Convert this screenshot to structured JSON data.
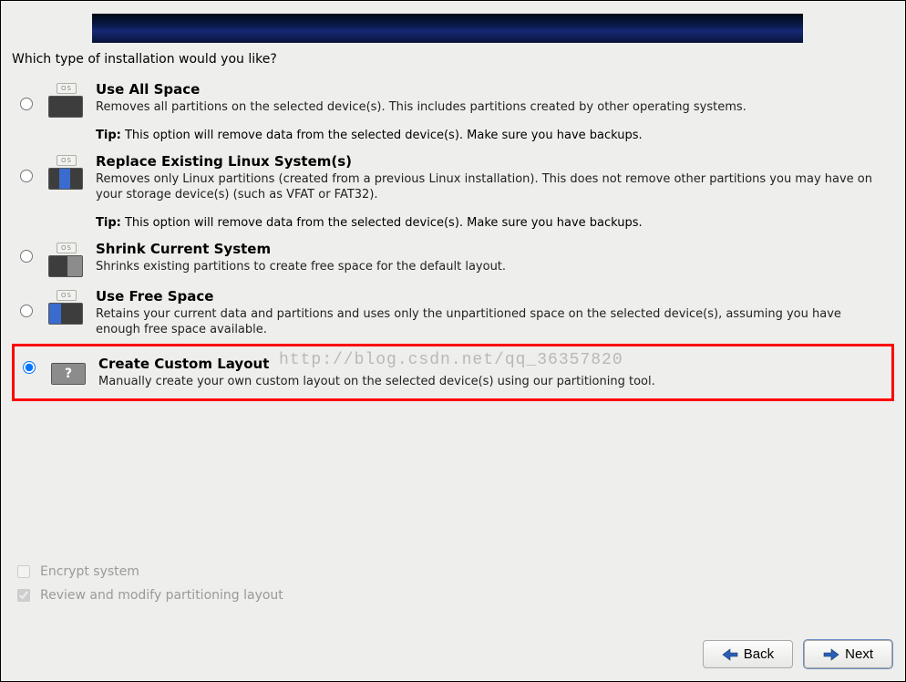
{
  "prompt": "Which type of installation would you like?",
  "watermark": "http://blog.csdn.net/qq_36357820",
  "options": [
    {
      "title": "Use All Space",
      "desc": "Removes all partitions on the selected device(s).  This includes partitions created by other operating systems.",
      "tip_label": "Tip:",
      "tip": "This option will remove data from the selected device(s).  Make sure you have backups."
    },
    {
      "title": "Replace Existing Linux System(s)",
      "desc": "Removes only Linux partitions (created from a previous Linux installation).  This does not remove other partitions you may have on your storage device(s) (such as VFAT or FAT32).",
      "tip_label": "Tip:",
      "tip": "This option will remove data from the selected device(s).  Make sure you have backups."
    },
    {
      "title": "Shrink Current System",
      "desc": "Shrinks existing partitions to create free space for the default layout."
    },
    {
      "title": "Use Free Space",
      "desc": "Retains your current data and partitions and uses only the unpartitioned space on the selected device(s), assuming you have enough free space available."
    },
    {
      "title": "Create Custom Layout",
      "desc": "Manually create your own custom layout on the selected device(s) using our partitioning tool."
    }
  ],
  "checkboxes": {
    "encrypt": "Encrypt system",
    "review": "Review and modify partitioning layout"
  },
  "buttons": {
    "back": "Back",
    "next": "Next"
  },
  "icon_tag": "OS"
}
